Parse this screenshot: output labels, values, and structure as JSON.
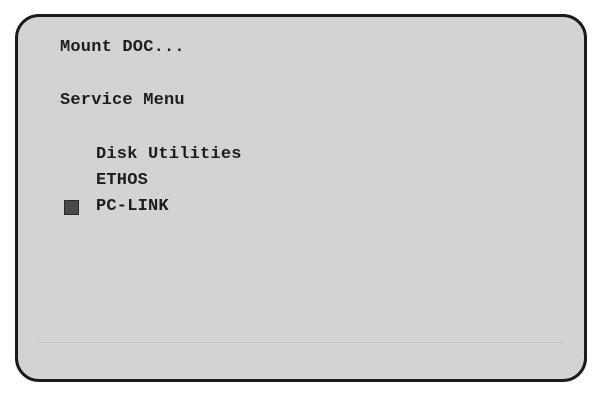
{
  "screen": {
    "title": "Mount DOC...",
    "section_title": "Service Menu",
    "menu_items": [
      {
        "label": "Disk Utilities"
      },
      {
        "label": "ETHOS"
      },
      {
        "label": "PC-LINK"
      }
    ]
  },
  "selection_cursor_icon": "square-selection-marker",
  "colors": {
    "screen_background": "#d3d3d3",
    "text": "#1d1d1d",
    "border": "#1b1b1b",
    "cursor": "#4a4a4a"
  }
}
